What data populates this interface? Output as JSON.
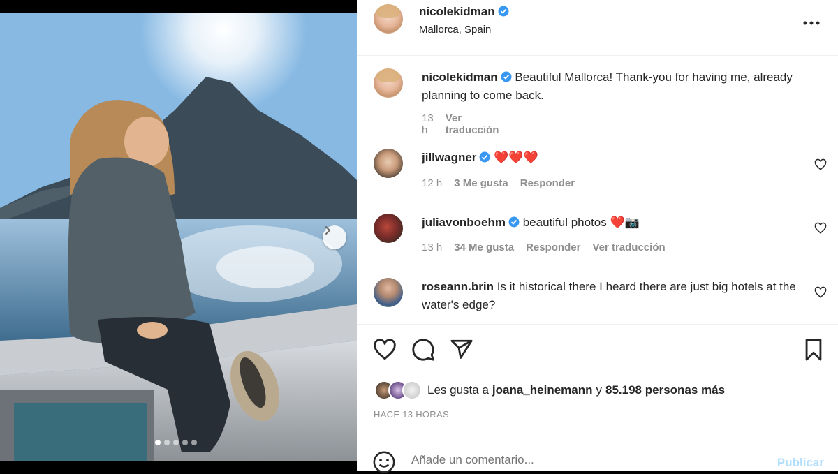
{
  "post": {
    "author": "nicolekidman",
    "location": "Mallorca, Spain",
    "caption": "Beautiful Mallorca! Thank-you for having me, already planning to come back.",
    "caption_time": "13 h",
    "caption_translate": "Ver traducción"
  },
  "carousel": {
    "dot_count": 5,
    "active_index": 0
  },
  "comments": [
    {
      "user": "jillwagner",
      "text": "❤️❤️❤️",
      "time": "12 h",
      "likes": "3 Me gusta",
      "reply": "Responder",
      "translate": ""
    },
    {
      "user": "juliavonboehm",
      "text": "beautiful photos ❤️📷",
      "time": "13 h",
      "likes": "34 Me gusta",
      "reply": "Responder",
      "translate": "Ver traducción"
    },
    {
      "user": "roseann.brin",
      "text": "Is it historical there I heard there are just big hotels at the water's edge?",
      "time": "",
      "likes": "",
      "reply": "",
      "translate": ""
    }
  ],
  "likes": {
    "prefix": "Les gusta a",
    "user": "joana_heinemann",
    "conjunction": "y",
    "others": "85.198 personas más"
  },
  "timestamp": "HACE 13 HORAS",
  "add_comment": {
    "placeholder": "Añade un comentario...",
    "publish": "Publicar"
  },
  "colors": {
    "verified": "#3897f0",
    "heart": "#ed4956",
    "publish_disabled": "#b2dffc",
    "secondary_text": "#8e8e8e"
  },
  "icons": [
    "verified-icon",
    "more-icon",
    "heart-icon",
    "comment-icon",
    "share-icon",
    "bookmark-icon",
    "emoji-icon",
    "chevron-right-icon"
  ]
}
